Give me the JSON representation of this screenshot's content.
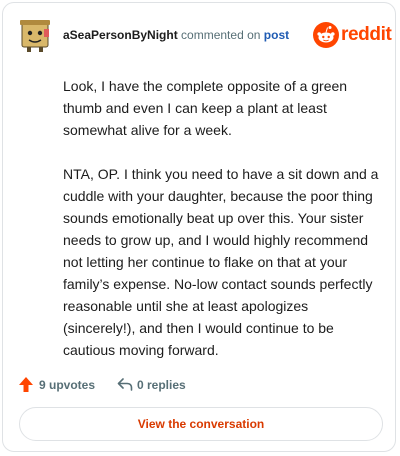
{
  "comment": {
    "author": "aSeaPersonByNight",
    "action_text": "commented on",
    "target_link": "post",
    "paragraphs": [
      "Look, I have the complete opposite of a green thumb and even I can keep a plant at least somewhat alive for a week.",
      "NTA, OP. I think you need to have a sit down and a cuddle with your daughter, because the poor thing sounds emotionally beat up over this. Your sister needs to grow up, and I would highly recommend not letting her continue to flake on that at your family’s expense. No-low contact sounds perfectly reasonable until she at least apologizes (sincerely!), and then I would continue to be cautious moving forward."
    ]
  },
  "brand": {
    "name": "reddit",
    "color": "#ff4500"
  },
  "actions": {
    "upvotes_label": "9 upvotes",
    "replies_label": "0 replies",
    "upvote_icon": "upvote-arrow-icon",
    "reply_icon": "reply-arrow-icon"
  },
  "footer": {
    "button_label": "View the conversation"
  },
  "colors": {
    "accent": "#ff4500",
    "link": "#1f5bb3",
    "button_text": "#d93a00",
    "muted": "#576f76"
  }
}
